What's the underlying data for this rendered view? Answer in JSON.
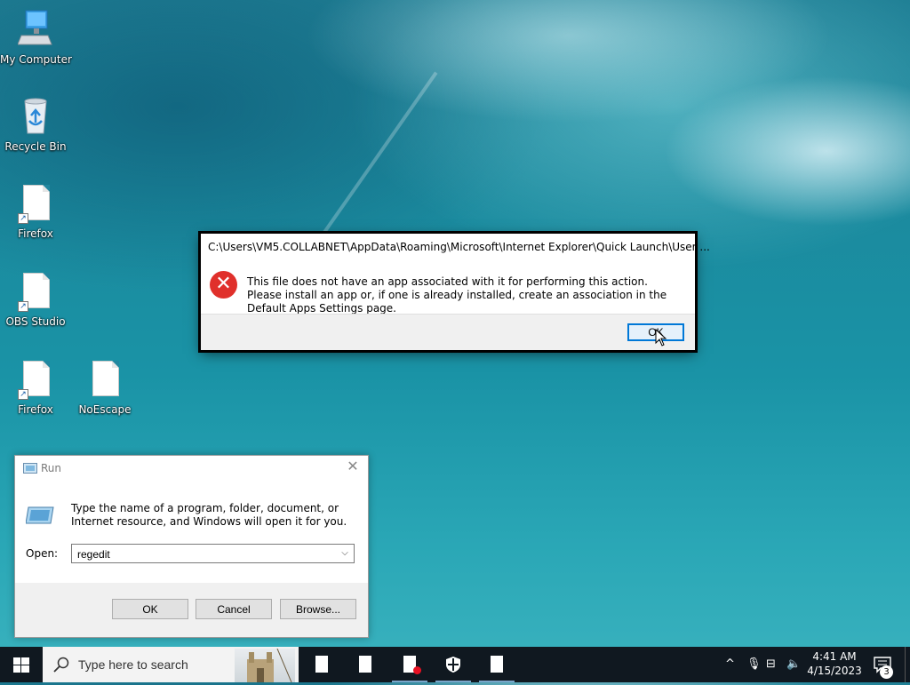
{
  "desktop": {
    "icons": [
      {
        "label": "My Computer",
        "icon": "computer-icon"
      },
      {
        "label": "Recycle Bin",
        "icon": "recycle-bin-icon"
      },
      {
        "label": "Firefox",
        "icon": "file-shortcut-icon"
      },
      {
        "label": "OBS Studio",
        "icon": "file-shortcut-icon"
      },
      {
        "label": "Firefox",
        "icon": "file-shortcut-icon"
      },
      {
        "label": "NoEscape",
        "icon": "file-icon"
      }
    ]
  },
  "error_dialog": {
    "title": "C:\\Users\\VM5.COLLABNET\\AppData\\Roaming\\Microsoft\\Internet Explorer\\Quick Launch\\User ...",
    "message": "This file does not have an app associated with it for performing this action. Please install an app or, if one is already installed, create an association in the Default Apps Settings page.",
    "ok_label": "OK",
    "icon": "error-icon"
  },
  "run_dialog": {
    "title": "Run",
    "description": "Type the name of a program, folder, document, or Internet resource, and Windows will open it for you.",
    "open_label": "Open:",
    "open_value": "regedit",
    "ok_label": "OK",
    "cancel_label": "Cancel",
    "browse_label": "Browse..."
  },
  "taskbar": {
    "search_placeholder": "Type here to search",
    "time": "4:41 AM",
    "date": "4/15/2023",
    "notification_count": "3"
  },
  "colors": {
    "taskbar_bg": "#101820",
    "accent": "#0078d7",
    "error_red": "#e0302b",
    "record_red": "#e81123"
  }
}
